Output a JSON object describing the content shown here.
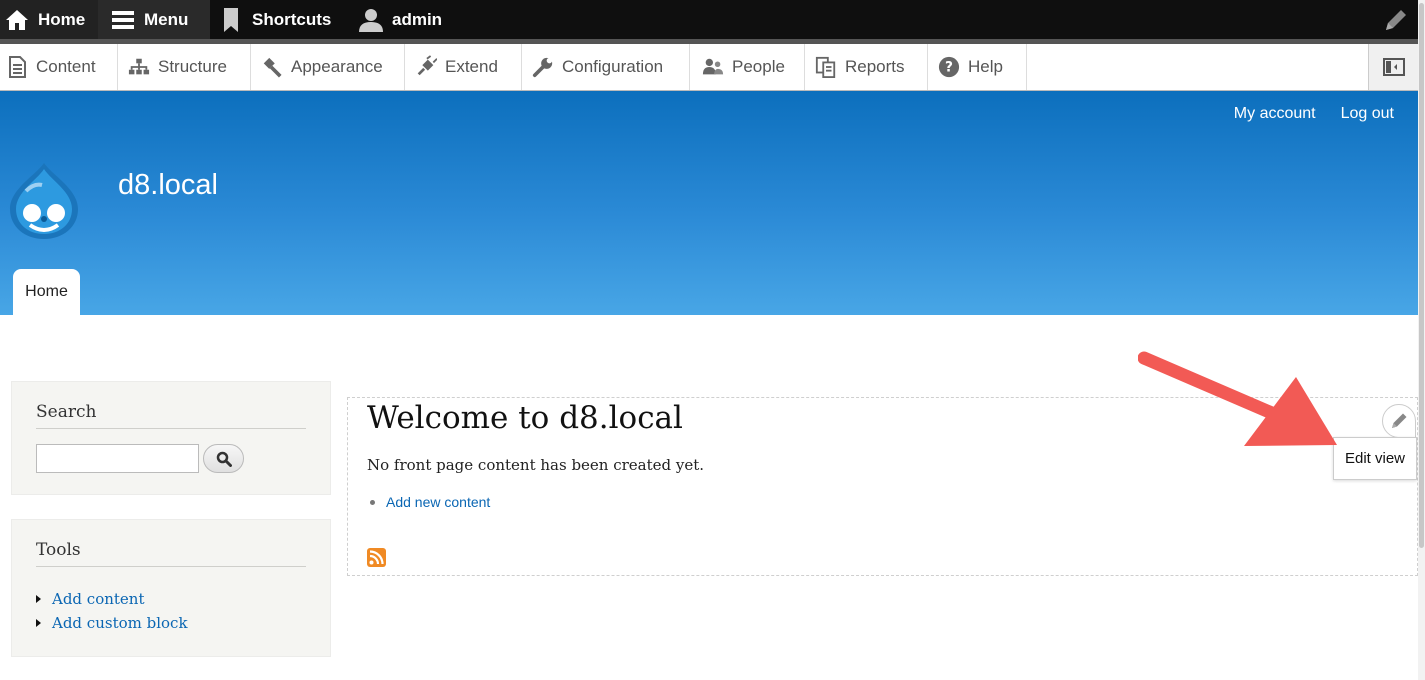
{
  "toolbar": {
    "home_label": "Home",
    "menu_label": "Menu",
    "shortcuts_label": "Shortcuts",
    "user_label": "admin",
    "icons": [
      "home-icon",
      "hamburger-icon",
      "bookmark-icon",
      "user-icon",
      "pencil-icon"
    ]
  },
  "tray": {
    "items": [
      {
        "label": "Content",
        "icon": "document-icon"
      },
      {
        "label": "Structure",
        "icon": "sitemap-icon"
      },
      {
        "label": "Appearance",
        "icon": "brush-icon"
      },
      {
        "label": "Extend",
        "icon": "plug-icon"
      },
      {
        "label": "Configuration",
        "icon": "wrench-icon"
      },
      {
        "label": "People",
        "icon": "people-icon"
      },
      {
        "label": "Reports",
        "icon": "reports-icon"
      },
      {
        "label": "Help",
        "icon": "help-icon"
      }
    ],
    "toggle_icon": "sidebar-toggle-icon"
  },
  "header": {
    "site_name": "d8.local",
    "secondary_links": [
      "My account",
      "Log out"
    ],
    "primary_tab": "Home",
    "colors": {
      "gradient_top": "#0c6fbd",
      "gradient_bottom": "#48a6e6"
    }
  },
  "sidebar": {
    "search": {
      "title": "Search",
      "input_value": "",
      "button_icon": "magnifier-icon"
    },
    "tools": {
      "title": "Tools",
      "links": [
        "Add content",
        "Add custom block"
      ]
    }
  },
  "main": {
    "title": "Welcome to d8.local",
    "empty_text": "No front page content has been created yet.",
    "links": [
      "Add new content"
    ],
    "feed_icon": "rss-icon"
  },
  "contextual": {
    "trigger_icon": "pencil-icon",
    "menu_label": "Edit view"
  },
  "annotation": {
    "color": "#f25a55",
    "icon": "arrow-icon"
  }
}
